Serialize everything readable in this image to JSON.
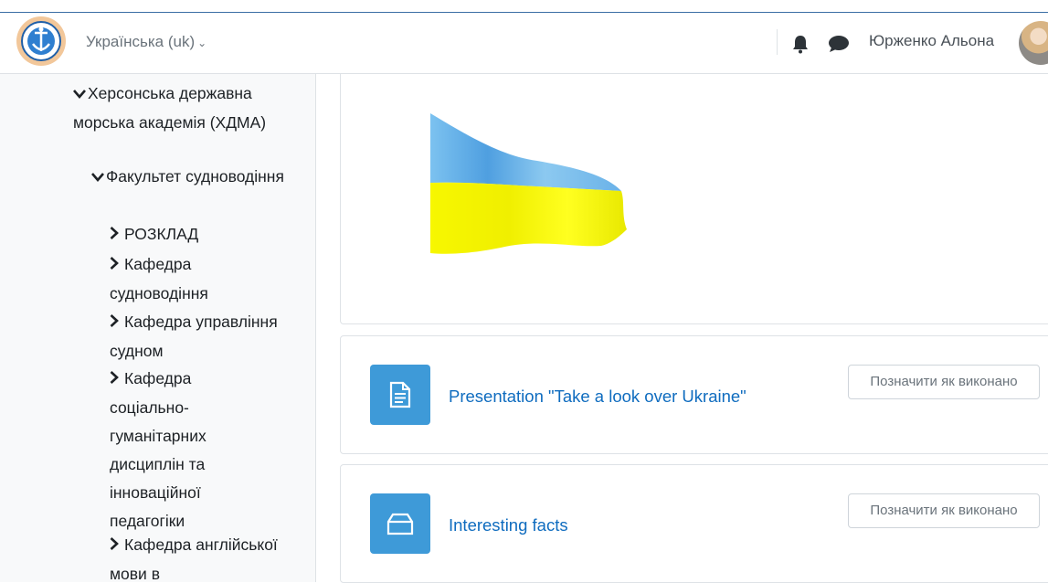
{
  "header": {
    "language_label": "Українська ‎(uk)‎",
    "language_chevron": "⌄",
    "user_name": "Юрженко Альона"
  },
  "nav_tree": [
    {
      "label": "Херсонська державна морська академія (ХДМА)",
      "state": "expanded"
    },
    {
      "label": "Факультет судноводіння",
      "state": "expanded"
    },
    {
      "label": "РОЗКЛАД",
      "state": "collapsed"
    },
    {
      "label": "Кафедра судноводіння",
      "state": "collapsed"
    },
    {
      "label": "Кафедра управління судном",
      "state": "collapsed"
    },
    {
      "label": "Кафедра соціально-гуманітарних дисциплін та інноваційної педагогіки",
      "state": "collapsed"
    },
    {
      "label": "Кафедра англійської мови в",
      "state": "collapsed"
    }
  ],
  "activities": [
    {
      "title": "Presentation \"Take a look over Ukraine\"",
      "icon": "file-icon",
      "button": "Позначити як виконано"
    },
    {
      "title": "Interesting facts",
      "icon": "folder-icon",
      "button": "Позначити як виконано"
    }
  ],
  "colors": {
    "link": "#0f6cbf",
    "activity_icon_bg": "#3e9ad8",
    "flag_blue": "#5aa8e6",
    "flag_yellow": "#f5f500"
  }
}
